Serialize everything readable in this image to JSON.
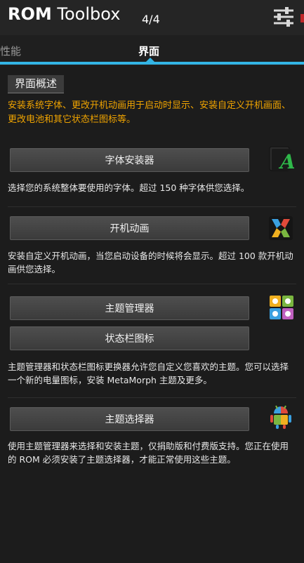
{
  "header": {
    "title_bold": "ROM",
    "title_rest": " Toolbox",
    "page_indicator": "4/4",
    "settings_icon": "sliders-icon"
  },
  "tabs": [
    {
      "label": "性能",
      "active": false
    },
    {
      "label": "界面",
      "active": true
    }
  ],
  "section": {
    "title": "界面概述",
    "intro": "安装系统字体、更改开机动画用于启动时显示、安装自定义开机画面、更改电池和其它状态栏图标等。"
  },
  "items": [
    {
      "buttons": [
        "字体安装器"
      ],
      "icon": "font-installer-icon",
      "description": "选择您的系统整体要使用的字体。超过 150 种字体供您选择。"
    },
    {
      "buttons": [
        "开机动画"
      ],
      "icon": "boot-animation-icon",
      "description": "安装自定义开机动画，当您启动设备的时候将会显示。超过 100 款开机动画供您选择。"
    },
    {
      "buttons": [
        "主题管理器",
        "状态栏图标"
      ],
      "icon": "theme-manager-icon",
      "description": "主题管理器和状态栏图标更换器允许您自定义您喜欢的主题。您可以选择一个新的电量图标，安装 MetaMorph 主题及更多。"
    },
    {
      "buttons": [
        "主题选择器"
      ],
      "icon": "theme-chooser-icon",
      "description": "使用主题管理器来选择和安装主题，仅捐助版和付费版支持。您正在使用的 ROM 必须安装了主题选择器，才能正常使用这些主题。"
    }
  ],
  "colors": {
    "accent": "#33b5e5",
    "intro_text": "#f0a400",
    "background": "#1c1c1c"
  }
}
